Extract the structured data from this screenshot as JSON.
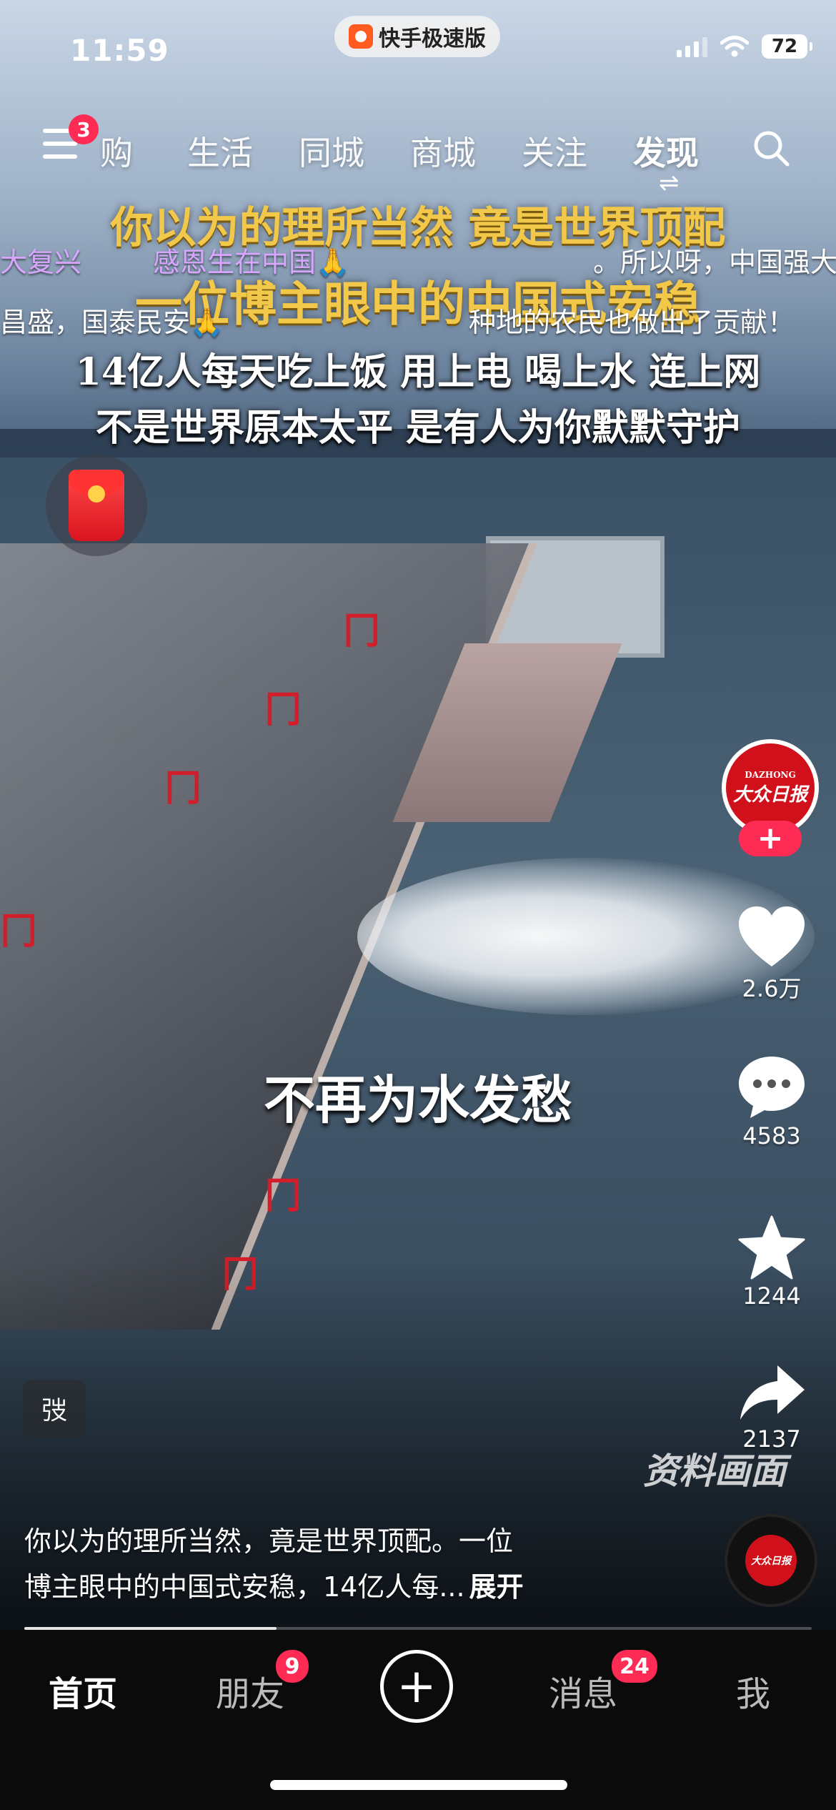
{
  "status_bar": {
    "time": "11:59",
    "app_pill": "快手极速版",
    "battery": "72"
  },
  "nav": {
    "menu_badge": "3",
    "tabs": [
      "购",
      "生活",
      "同城",
      "商城",
      "关注",
      "发现"
    ],
    "active_tab": "发现",
    "swap_glyph": "⇌"
  },
  "captions": {
    "line1": "你以为的理所当然 竟是世界顶配",
    "line2": "一位博主眼中的中国式安稳",
    "line3": "14亿人每天吃上饭 用上电 喝上水 连上网",
    "line4": "不是世界原本太平 是有人为你默默守护",
    "middle": "不再为水发愁",
    "watermark": "资料画面"
  },
  "danmu": [
    {
      "text": "大复兴",
      "color": "#d9a6ff"
    },
    {
      "text": "感恩生在中国🙏",
      "color": "#d9a6ff"
    },
    {
      "text": "。所以呀，中国强大",
      "color": "#ffffff"
    },
    {
      "text": "昌盛，国泰民安🙏",
      "color": "#ffffff"
    },
    {
      "text": "种地的农民也做出了贡献！",
      "color": "#ffffff"
    }
  ],
  "avatar": {
    "small": "DAZHONG",
    "large": "大众日报"
  },
  "actions": {
    "likes": "2.6万",
    "comments": "4583",
    "favorites": "1244",
    "shares": "2137"
  },
  "speed_label": "弢",
  "description": {
    "line1": "你以为的理所当然，竟是世界顶配。一位",
    "line2": "博主眼中的中国式安稳，14亿人每...",
    "more": "展开"
  },
  "progress_fraction": 0.32,
  "tabbar": {
    "home": "首页",
    "friends": "朋友",
    "friends_badge": "9",
    "create": "+",
    "messages": "消息",
    "messages_badge": "24",
    "me": "我"
  },
  "colors": {
    "accent": "#fe2c55",
    "caption_yellow": "#f2c84b",
    "tabbar_bg": "#0b0b0b"
  }
}
